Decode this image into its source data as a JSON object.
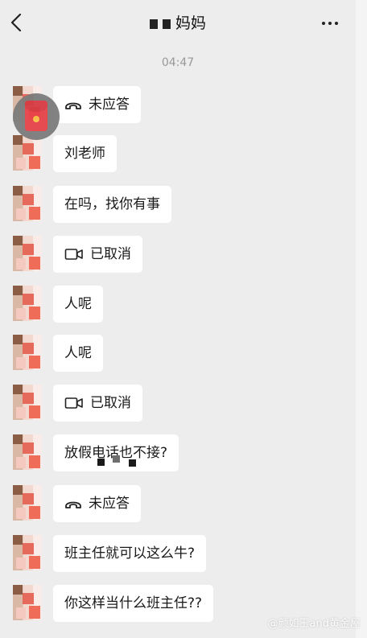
{
  "header": {
    "title": "妈妈",
    "back_icon": "chevron-left-icon",
    "more_icon": "more-horizontal-icon"
  },
  "timestamp": "04:47",
  "messages": [
    {
      "type": "call",
      "icon": "phone-missed-icon",
      "text": "未应答"
    },
    {
      "type": "text",
      "text": "刘老师"
    },
    {
      "type": "text",
      "text": "在吗，找你有事"
    },
    {
      "type": "call",
      "icon": "video-icon",
      "text": "已取消"
    },
    {
      "type": "text",
      "text": "人呢"
    },
    {
      "type": "text",
      "text": "人呢"
    },
    {
      "type": "call",
      "icon": "video-icon",
      "text": "已取消"
    },
    {
      "type": "text",
      "text": "放假电话也不接?"
    },
    {
      "type": "call",
      "icon": "phone-missed-icon",
      "text": "未应答"
    },
    {
      "type": "text",
      "text": "班主任就可以这么牛?"
    },
    {
      "type": "text",
      "text": "你这样当什么班主任??"
    }
  ],
  "floating": {
    "icon": "red-packet-icon"
  },
  "watermark": "@颜如玉and黄金屋"
}
